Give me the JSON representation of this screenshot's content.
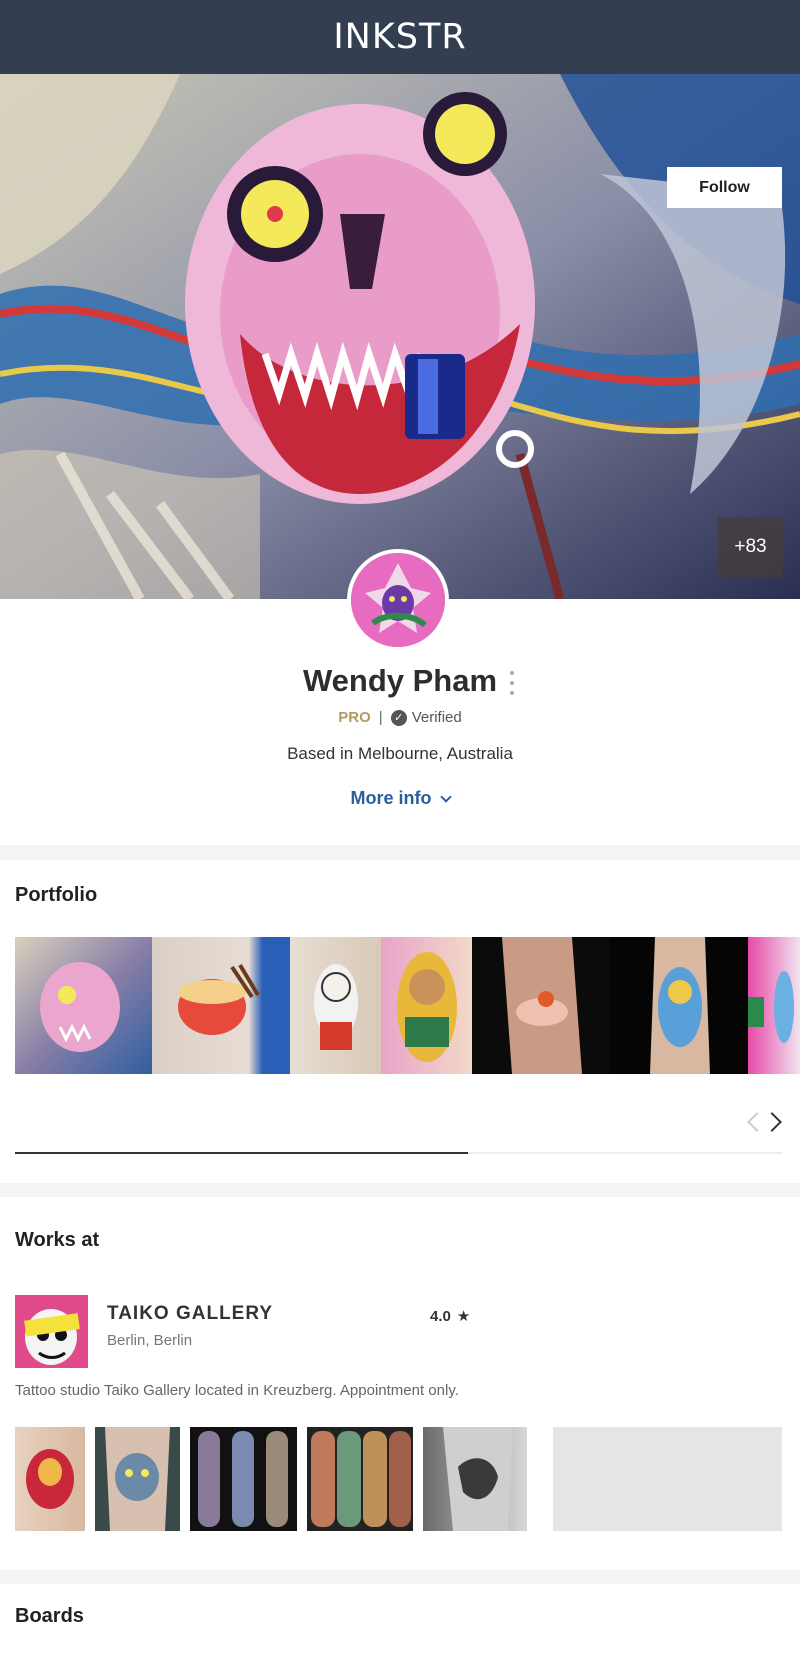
{
  "header": {
    "brand": "INKSTR"
  },
  "cover": {
    "follow_label": "Follow",
    "more_photos": "+83"
  },
  "profile": {
    "name": "Wendy Pham",
    "pro_label": "PRO",
    "separator": "|",
    "verified_label": "Verified",
    "location": "Based in Melbourne, Australia",
    "more_info_label": "More info"
  },
  "portfolio": {
    "title": "Portfolio"
  },
  "works_at": {
    "title": "Works at",
    "studio_name": "TAIKO GALLERY",
    "studio_location": "Berlin, Berlin",
    "rating": "4.0",
    "description": "Tattoo studio Taiko Gallery located in Kreuzberg. Appointment only."
  },
  "boards": {
    "title": "Boards"
  },
  "colors": {
    "header_bg": "#333f51",
    "link": "#2b5e9c",
    "pro": "#b5995a"
  }
}
